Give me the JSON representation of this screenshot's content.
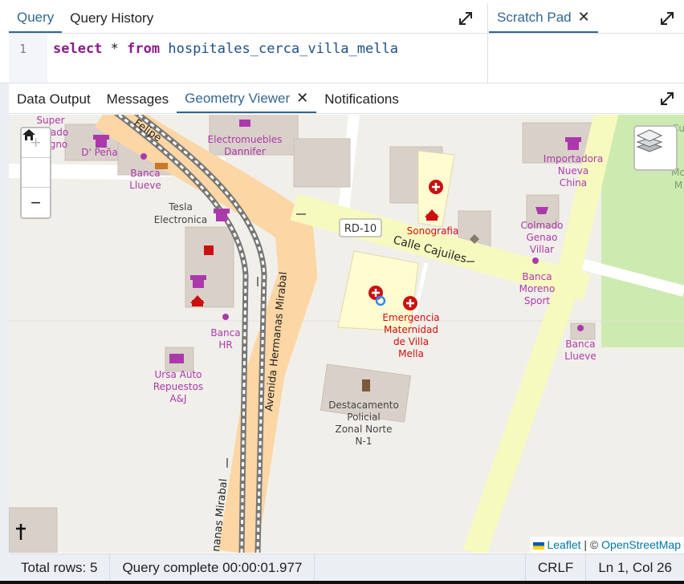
{
  "query_editor": {
    "tabs": [
      {
        "label": "Query",
        "active": true
      },
      {
        "label": "Query History",
        "active": false
      }
    ],
    "line_number": "1",
    "sql": {
      "kw_select": "select",
      "star": "*",
      "kw_from": "from",
      "table": "hospitales_cerca_villa_mella"
    }
  },
  "scratch_pad": {
    "tab_label": "Scratch Pad"
  },
  "output_tabs": [
    {
      "label": "Data Output",
      "active": false
    },
    {
      "label": "Messages",
      "active": false
    },
    {
      "label": "Geometry Viewer",
      "active": true
    },
    {
      "label": "Notifications",
      "active": false
    }
  ],
  "map": {
    "controls": {
      "zoom_in": "+",
      "zoom_out": "−"
    },
    "road_labels": {
      "felipe": "Felipe",
      "rd10": "RD-10",
      "calle_cajuiles": "Calle Cajuiles",
      "avenida_1": "Avenida Hermanas Mirabal",
      "avenida_2": "nanas Mirabal"
    },
    "poi_labels": {
      "super": "Super",
      "ado": "ado",
      "gno": "gno",
      "d_pena": "D' Peña",
      "electromuebles_1": "Electromuebles",
      "electromuebles_2": "Dannifer",
      "banca_llueve_1a": "Banca",
      "banca_llueve_1b": "Llueve",
      "tesla_1": "Tesla",
      "tesla_2": "Electronica",
      "sonografia": "Sonografia",
      "importadora_1": "Importadora",
      "importadora_2": "Nueva",
      "importadora_3": "China",
      "colmado_1": "Colmado",
      "colmado_2": "Genao",
      "colmado_3": "Villar",
      "banca_moreno_1": "Banca",
      "banca_moreno_2": "Moreno",
      "banca_moreno_3": "Sport",
      "banca_llueve_2a": "Banca",
      "banca_llueve_2b": "Llueve",
      "banca_hr_1": "Banca",
      "banca_hr_2": "HR",
      "ursa_1": "Ursa Auto",
      "ursa_2": "Repuestos",
      "ursa_3": "A&J",
      "emergencia_1": "Emergencia",
      "emergencia_2": "Maternidad",
      "emergencia_3": "de Villa",
      "emergencia_4": "Mella",
      "destacamento_1": "Destacamento",
      "destacamento_2": "Policial",
      "destacamento_3": "Zonal Norte",
      "destacamento_4": "N-1",
      "right_edge_1": "Cu",
      "right_edge_2": "Mo",
      "right_edge_3": "M"
    },
    "attribution": {
      "leaflet": "Leaflet",
      "separator": "| ©",
      "osm": "OpenStreetMap"
    },
    "colors": {
      "land": "#f1efe9",
      "building": "#d9d0c9",
      "hospital_area": "#fffcd2",
      "primary_road": "#f7fabf",
      "trunk_road": "#fcd6a4",
      "park": "#cdebb0",
      "poi_magenta": "#ac39ac",
      "hospital_red": "#cc1010",
      "marker_blue": "#3388ff"
    }
  },
  "status_bar": {
    "total_rows": "Total rows: 5",
    "query_status": "Query complete 00:00:01.977",
    "line_ending": "CRLF",
    "cursor": "Ln 1, Col 26"
  }
}
